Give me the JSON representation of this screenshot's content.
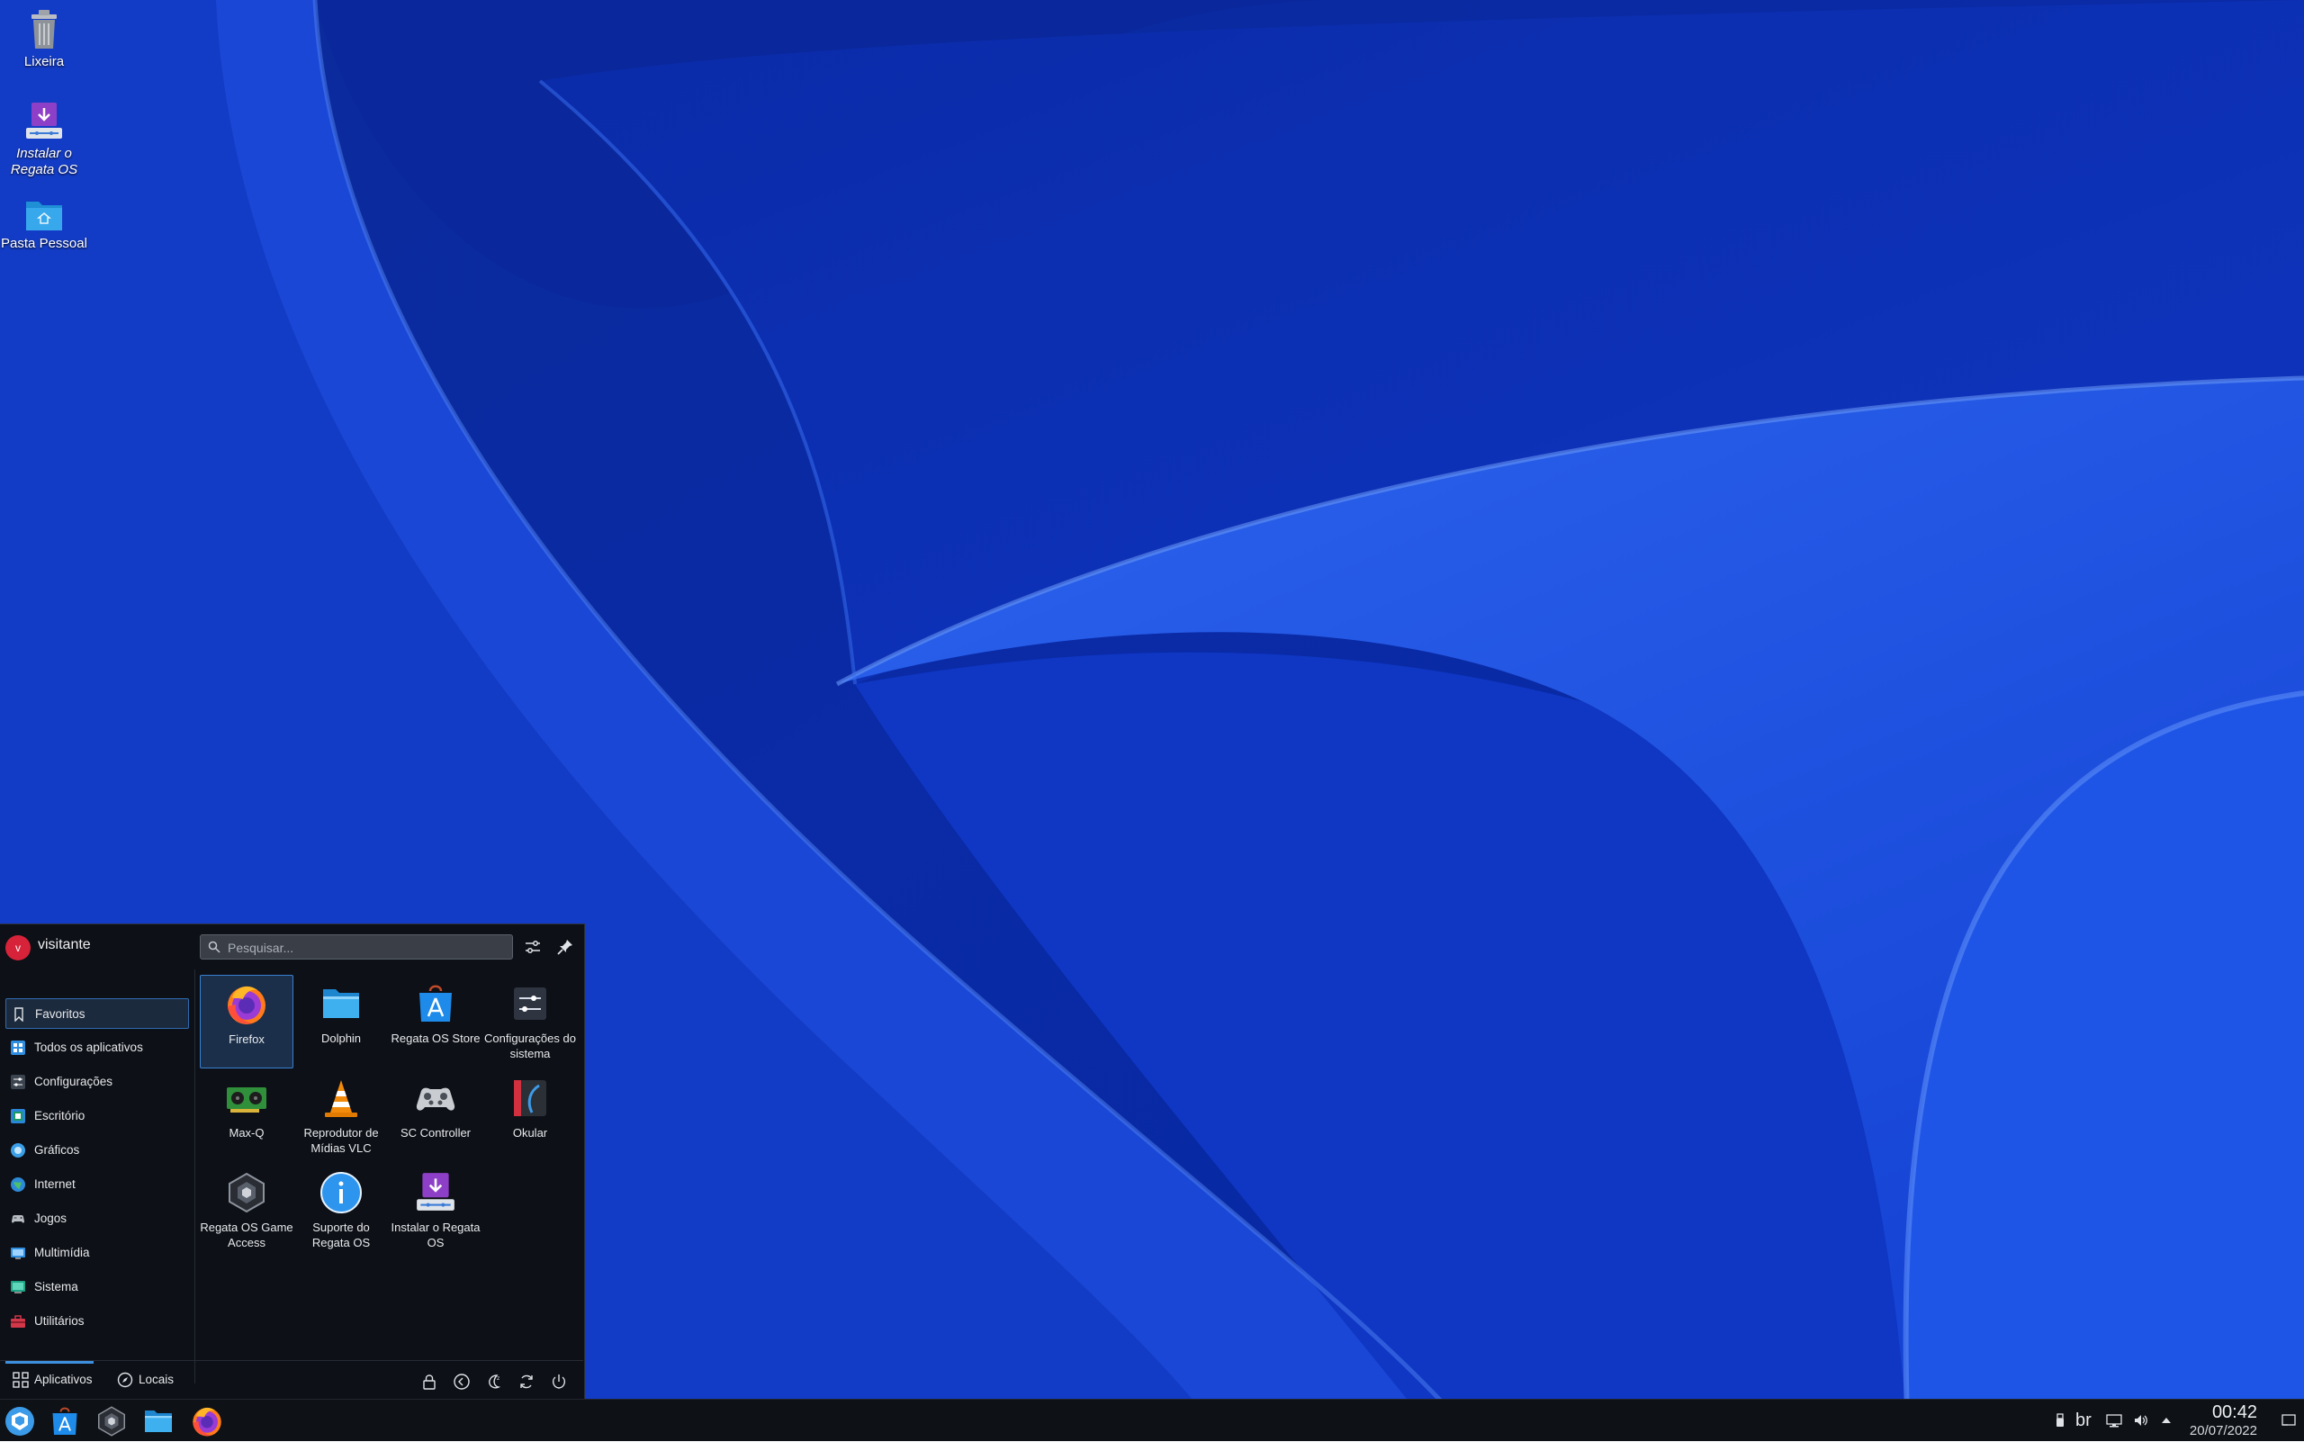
{
  "desktop": {
    "icons": [
      {
        "label": "Lixeira",
        "icon": "trash-icon"
      },
      {
        "label": "Instalar o Regata OS",
        "icon": "installer-icon"
      },
      {
        "label": "Pasta Pessoal",
        "icon": "home-folder-icon"
      }
    ]
  },
  "launcher": {
    "user": {
      "avatar_letter": "v",
      "name": "visitante"
    },
    "search": {
      "placeholder": "Pesquisar..."
    },
    "categories": [
      {
        "label": "Favoritos",
        "icon": "bookmark-icon",
        "active": true
      },
      {
        "label": "Todos os aplicativos",
        "icon": "all-apps-icon"
      },
      {
        "label": "Configurações",
        "icon": "settings-icon"
      },
      {
        "label": "Escritório",
        "icon": "office-icon"
      },
      {
        "label": "Gráficos",
        "icon": "graphics-icon"
      },
      {
        "label": "Internet",
        "icon": "internet-icon"
      },
      {
        "label": "Jogos",
        "icon": "gamepad-icon"
      },
      {
        "label": "Multimídia",
        "icon": "multimedia-icon"
      },
      {
        "label": "Sistema",
        "icon": "system-icon"
      },
      {
        "label": "Utilitários",
        "icon": "utilities-icon"
      }
    ],
    "apps": [
      {
        "label": "Firefox",
        "icon": "firefox-icon",
        "selected": true
      },
      {
        "label": "Dolphin",
        "icon": "folder-icon"
      },
      {
        "label": "Regata OS Store",
        "icon": "store-icon"
      },
      {
        "label": "Configurações do sistema",
        "icon": "system-settings-icon"
      },
      {
        "label": "Max-Q",
        "icon": "gpu-card-icon"
      },
      {
        "label": "Reprodutor de Mídias VLC",
        "icon": "vlc-cone-icon"
      },
      {
        "label": "SC Controller",
        "icon": "controller-icon"
      },
      {
        "label": "Okular",
        "icon": "okular-icon"
      },
      {
        "label": "Regata OS Game Access",
        "icon": "game-access-icon"
      },
      {
        "label": "Suporte do Regata OS",
        "icon": "info-icon"
      },
      {
        "label": "Instalar o Regata OS",
        "icon": "installer-icon"
      }
    ],
    "footer": {
      "tabs": [
        {
          "label": "Aplicativos",
          "icon": "grid-icon",
          "active": true
        },
        {
          "label": "Locais",
          "icon": "compass-icon"
        }
      ],
      "actions": [
        "lock-icon",
        "logout-icon",
        "sleep-icon",
        "restart-icon",
        "power-icon"
      ]
    }
  },
  "taskbar": {
    "items": [
      "regata-menu-icon",
      "store-icon",
      "game-access-icon",
      "file-manager-icon",
      "firefox-icon"
    ],
    "tray": {
      "keyboard_layout": "br",
      "icons": [
        "usb-device-icon",
        "network-icon",
        "volume-icon",
        "expand-tray-icon"
      ]
    },
    "clock": {
      "time": "00:42",
      "date": "20/07/2022"
    }
  },
  "colors": {
    "accent": "#3d8fe0",
    "panel": "#0d1016",
    "wallpaper_blue": "#1239c4"
  }
}
